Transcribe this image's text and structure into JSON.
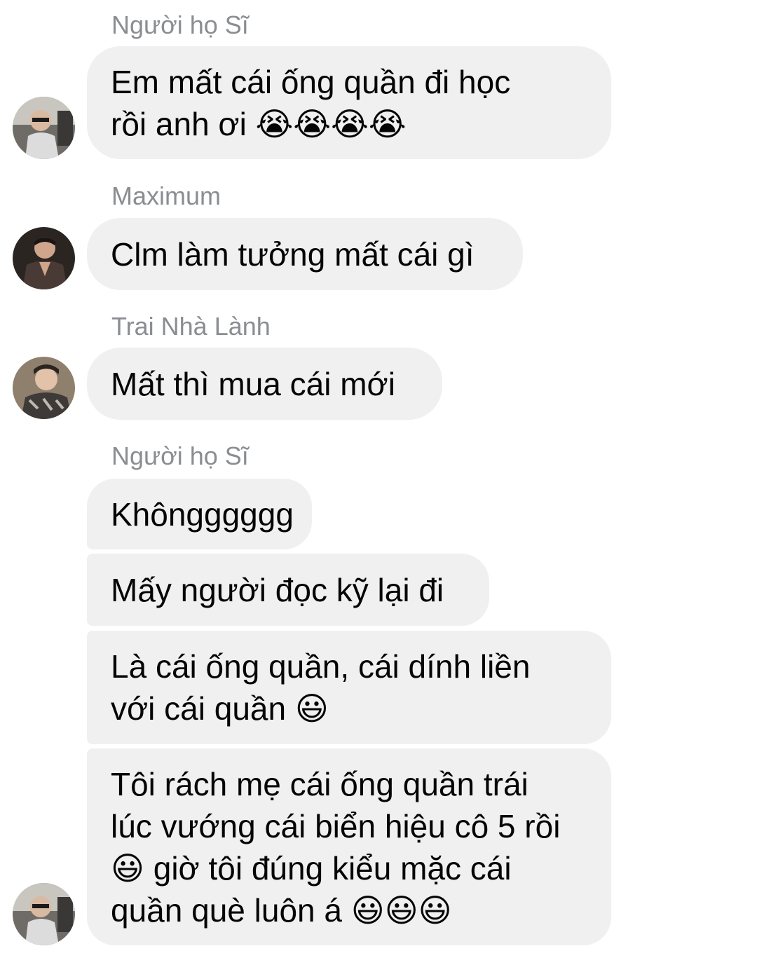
{
  "messages": [
    {
      "sender": "Người họ Sĩ",
      "bubbles": [
        {
          "lines": [
            "Em mất cái ống quần đi học",
            "rồi anh ơi 😭😭😭😭"
          ]
        }
      ]
    },
    {
      "sender": "Maximum",
      "bubbles": [
        {
          "lines": [
            "Clm làm tưởng mất cái gì"
          ]
        }
      ]
    },
    {
      "sender": "Trai Nhà Lành",
      "bubbles": [
        {
          "lines": [
            "Mất thì mua cái mới"
          ]
        }
      ]
    },
    {
      "sender": "Người họ Sĩ",
      "bubbles": [
        {
          "lines": [
            "Khôngggggg"
          ]
        },
        {
          "lines": [
            "Mấy người đọc kỹ lại đi"
          ]
        },
        {
          "lines": [
            "Là cái ống quần, cái dính liền",
            "với cái quần 😃"
          ]
        },
        {
          "lines": [
            "Tôi rách mẹ cái ống quần trái",
            "lúc vướng cái biển hiệu cô 5 rồi",
            "😃 giờ tôi đúng kiểu mặc cái",
            "quần què luôn á 😃😃😃"
          ]
        }
      ]
    }
  ]
}
